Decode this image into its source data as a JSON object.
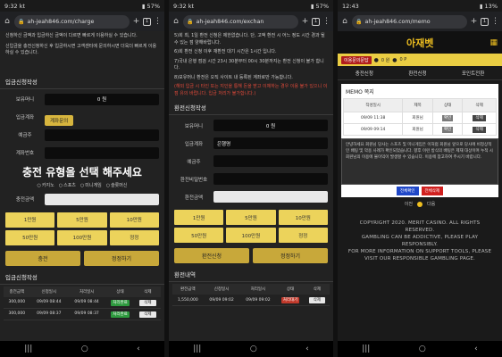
{
  "panels": [
    {
      "status": {
        "time": "9:32",
        "carrier": "kt",
        "battery": "57%"
      },
      "url": "ah-jeah846.com/charge",
      "tab_count": "1",
      "notes": [
        "신청하신 금액과 입금하신 금액이 다르면 빠르게 이용하실 수 있습니다.",
        "신입금을 충전신청하신 후 입금하시면 고객센터에 문의하시면 더욱더 빠르게 이용하실 수 있습니다."
      ],
      "section_title": "입금신청작성",
      "fields": [
        {
          "label": "보유머니",
          "value": "0 원"
        },
        {
          "label": "입금계좌",
          "button": "계좌문의"
        },
        {
          "label": "예금주",
          "value": ""
        },
        {
          "label": "계좌번호",
          "value": ""
        }
      ],
      "big_notice": "충전 유형을 선택 해주세요",
      "radio_options": [
        "카지노",
        "스포츠",
        "미니게임",
        "슬롯머신"
      ],
      "amount_label": "충전금액",
      "amount_value": "",
      "chips": [
        "1만원",
        "5만원",
        "10만원",
        "50만원",
        "100만원",
        "정정"
      ],
      "actions": [
        "충전",
        "정정하기"
      ],
      "history_title": "입금신청작성",
      "history_headers": [
        "충전금액",
        "신청일시",
        "처리일시",
        "상태",
        "삭제"
      ],
      "history_rows": [
        {
          "amount": "300,000",
          "req": "09/09 08:44",
          "proc": "09/09 08:44",
          "status": "처리완료",
          "del": "삭제"
        },
        {
          "amount": "300,000",
          "req": "09/09 08:37",
          "proc": "09/09 08:37",
          "status": "처리완료",
          "del": "삭제"
        }
      ]
    },
    {
      "status": {
        "time": "9:32",
        "carrier": "kt",
        "battery": "57%"
      },
      "url": "ah-jeah846.com/exchan",
      "tab_count": "1",
      "notes": [
        "5)회 최, 1일 환전 신청은 제한없습니다. 단, 고액 환전 시 어느 정도 시간 경과 될 수 있는 점 양해바랍니다.",
        "6)회 환전 신청 이후 재환전 대기 시간은 1시간 입니다.",
        "7)국내 은행 점검 시간 23시 30분부터 00시 30분까지는 환전 신청이 불가 합니다.",
        "8)보유머니 환전은 오직 사이트 내 등록된 계좌로만 가능합니다."
      ],
      "warn": "(해외 입금 시 타인 또는 지인을 통해 돈을 받고 이체하는 경우 이용 불가 있으니 이점 유의 바랍니다. 입금 처리가 불가합니다.)",
      "section_title": "환전신청작성",
      "fields": [
        {
          "label": "보유머니",
          "value": "0 원"
        },
        {
          "label": "입금계좌",
          "value": "은행명"
        },
        {
          "label": "예금주",
          "value": ""
        },
        {
          "label": "환전비밀번호",
          "value": ""
        }
      ],
      "amount_label": "환전금액",
      "amount_value": "",
      "chips": [
        "1만원",
        "5만원",
        "10만원",
        "50만원",
        "100만원",
        "정정"
      ],
      "actions": [
        "환전신청",
        "정정하기"
      ],
      "history_title": "환전내역",
      "history_headers": [
        "환전금액",
        "신청일시",
        "처리일시",
        "상태",
        "삭제"
      ],
      "history_rows": [
        {
          "amount": "1,550,000",
          "req": "09/09 09:02",
          "proc": "09/09 09:02",
          "status": "처리대기",
          "del": "삭제"
        }
      ]
    },
    {
      "status": {
        "time": "12:43",
        "battery": "13%"
      },
      "url": "ah-jeah846.com/memo",
      "tab_count": "1",
      "logo": "아재벳",
      "login_bar": {
        "button": "이용문의문답",
        "balance": "0 원",
        "points": "0 P"
      },
      "subtabs": [
        "충전신청",
        "환전신청",
        "포인트전환"
      ],
      "memo_title": "MEMO 쪽지",
      "memo_headers": [
        "작성일시",
        "제목",
        "상태",
        "삭제"
      ],
      "memo_rows": [
        {
          "date": "09/09 11:38",
          "title": "회원님",
          "state": "확인",
          "del": "삭제"
        },
        {
          "date": "09/09 09:14",
          "title": "회원님",
          "state": "확인",
          "del": "삭제"
        }
      ],
      "memo_body": "안녕하세요 회원님 당사는 스포츠 및 미니게임은 이처럼 회원님 앞으로 당사에 비정상적인 배팅 및 악용 사례가 확인되었습니다. 향후 이런 방식의 배팅은 제재 대상이며 누적 시 회원님의 이용에 불이익이 발생할 수 있습니다. 이용에 참고하여 주시기 바랍니다.",
      "memo_buttons": [
        "전체확인",
        "전체삭제"
      ],
      "pager": {
        "prev": "이전",
        "next": "다음"
      },
      "copyright": [
        "COPYRIGHT 2020. MERIT CASINO. ALL RIGHTS RESERVED.",
        "GAMBLING CAN BE ADDICTIVE, PLEASE PLAY RESPONSIBLY.",
        "FOR MORE INFORMATION ON SUPPORT TOOLS, PLEASE VISIT OUR RESPONSIBLE GAMBLING PAGE."
      ]
    }
  ]
}
